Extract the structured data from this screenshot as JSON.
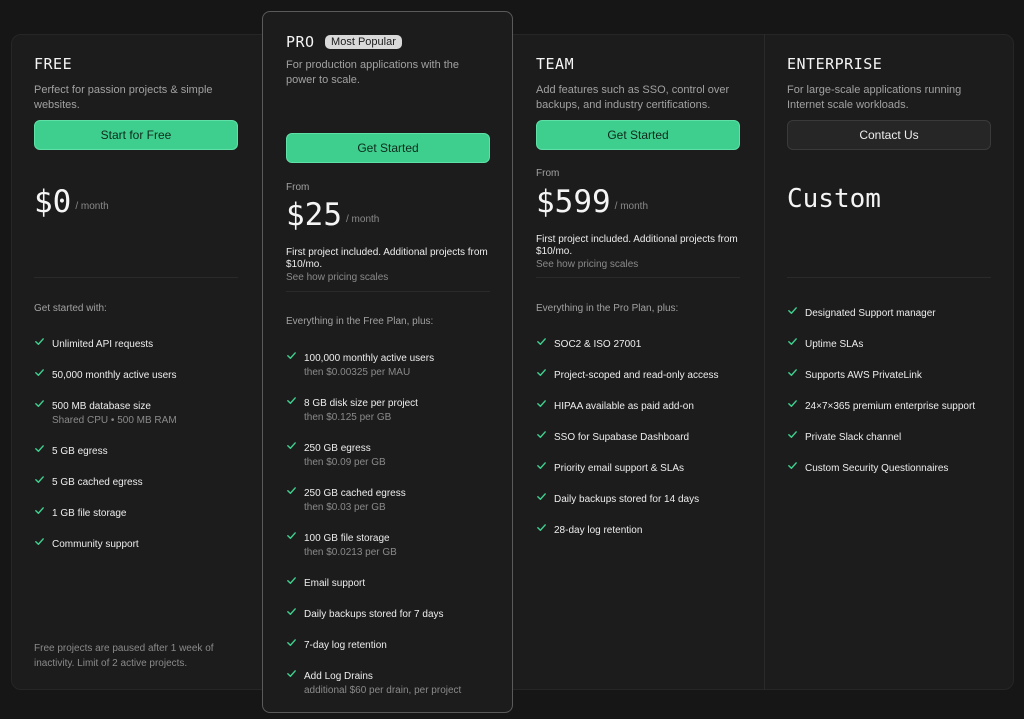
{
  "plans": {
    "free": {
      "title": "FREE",
      "description": "Perfect for passion projects & simple websites.",
      "button": "Start for Free",
      "price": "$0",
      "per": "/ month",
      "features_head": "Get started with:",
      "features": [
        {
          "text": "Unlimited API requests",
          "sub": ""
        },
        {
          "text": "50,000 monthly active users",
          "sub": ""
        },
        {
          "text": "500 MB database size",
          "sub": "Shared CPU • 500 MB RAM"
        },
        {
          "text": "5 GB egress",
          "sub": ""
        },
        {
          "text": "5 GB cached egress",
          "sub": ""
        },
        {
          "text": "1 GB file storage",
          "sub": ""
        },
        {
          "text": "Community support",
          "sub": ""
        }
      ],
      "footnote": "Free projects are paused after 1 week of inactivity. Limit of 2 active projects."
    },
    "pro": {
      "title": "PRO",
      "badge": "Most Popular",
      "description": "For production applications with the power to scale.",
      "button": "Get Started",
      "from": "From",
      "price": "$25",
      "per": "/ month",
      "note": "First project included. Additional projects from $10/mo.",
      "link": "See how pricing scales",
      "features_head": "Everything in the Free Plan, plus:",
      "features": [
        {
          "text": "100,000 monthly active users",
          "sub": "then $0.00325 per MAU"
        },
        {
          "text": "8 GB disk size per project",
          "sub": "then $0.125 per GB"
        },
        {
          "text": "250 GB egress",
          "sub": "then $0.09 per GB"
        },
        {
          "text": "250 GB cached egress",
          "sub": "then $0.03 per GB"
        },
        {
          "text": "100 GB file storage",
          "sub": "then $0.0213 per GB"
        },
        {
          "text": "Email support",
          "sub": ""
        },
        {
          "text": "Daily backups stored for 7 days",
          "sub": ""
        },
        {
          "text": "7-day log retention",
          "sub": ""
        },
        {
          "text": "Add Log Drains",
          "sub": "additional $60 per drain, per project"
        }
      ]
    },
    "team": {
      "title": "TEAM",
      "description": "Add features such as SSO, control over backups, and industry certifications.",
      "button": "Get Started",
      "from": "From",
      "price": "$599",
      "per": "/ month",
      "note": "First project included. Additional projects from $10/mo.",
      "link": "See how pricing scales",
      "features_head": "Everything in the Pro Plan, plus:",
      "features": [
        {
          "text": "SOC2 & ISO 27001",
          "sub": ""
        },
        {
          "text": "Project-scoped and read-only access",
          "sub": ""
        },
        {
          "text": "HIPAA available as paid add-on",
          "sub": ""
        },
        {
          "text": "SSO for Supabase Dashboard",
          "sub": ""
        },
        {
          "text": "Priority email support & SLAs",
          "sub": ""
        },
        {
          "text": "Daily backups stored for 14 days",
          "sub": ""
        },
        {
          "text": "28-day log retention",
          "sub": ""
        }
      ]
    },
    "enterprise": {
      "title": "ENTERPRISE",
      "description": "For large-scale applications running Internet scale workloads.",
      "button": "Contact Us",
      "price": "Custom",
      "features": [
        {
          "text": "Designated Support manager",
          "sub": ""
        },
        {
          "text": "Uptime SLAs",
          "sub": ""
        },
        {
          "text": "Supports AWS PrivateLink",
          "sub": ""
        },
        {
          "text": "24×7×365 premium enterprise support",
          "sub": ""
        },
        {
          "text": "Private Slack channel",
          "sub": ""
        },
        {
          "text": "Custom Security Questionnaires",
          "sub": ""
        }
      ]
    }
  },
  "colors": {
    "accent": "#3ecf8e",
    "background": "#161616",
    "card": "#1c1c1c"
  },
  "icons": {
    "feature": "check-icon"
  }
}
